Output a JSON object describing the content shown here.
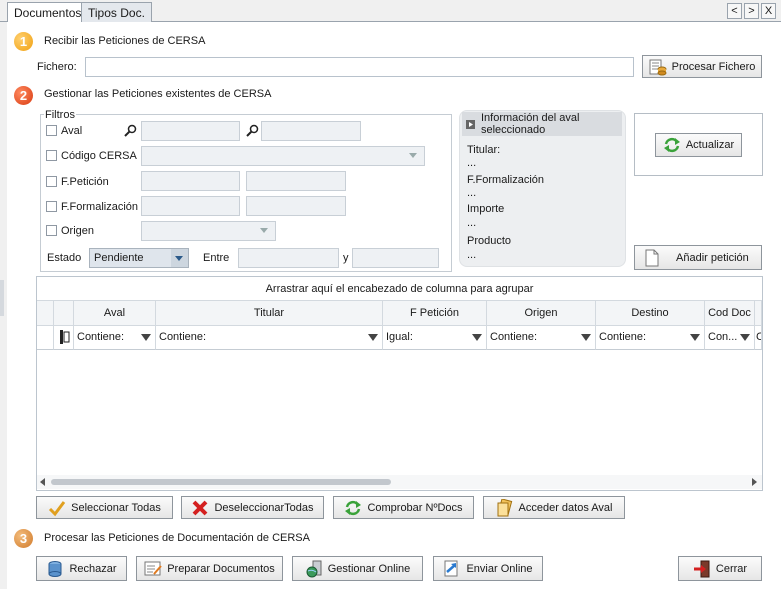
{
  "tabs": {
    "documentos": "Documentos",
    "tipos": "Tipos Doc."
  },
  "nav": {
    "prev": "<",
    "next": ">",
    "close": "X"
  },
  "step1": {
    "number": "1",
    "title": "Recibir las Peticiones de CERSA",
    "fichero_label": "Fichero:",
    "fichero_value": "",
    "procesar_btn": "Procesar Fichero"
  },
  "step2": {
    "number": "2",
    "title": "Gestionar las Peticiones existentes de CERSA"
  },
  "filtros": {
    "title": "Filtros",
    "aval": "Aval",
    "codigo": "Código CERSA",
    "fpeticion": "F.Petición",
    "fformalizacion": "F.Formalización",
    "origen": "Origen",
    "estado_label": "Estado",
    "estado_value": "Pendiente",
    "entre": "Entre",
    "y": "y"
  },
  "info": {
    "title": "Información del aval seleccionado",
    "titular": "Titular:",
    "titular_v": "...",
    "fform": "F.Formalización",
    "fform_v": "...",
    "importe": "Importe",
    "importe_v": "...",
    "producto": "Producto",
    "producto_v": "..."
  },
  "actualizar_btn": "Actualizar",
  "anadir_btn": "Añadir petición",
  "grid": {
    "group_hint": "Arrastrar aquí el encabezado de columna para agrupar",
    "columns": [
      "Aval",
      "Titular",
      "F Petición",
      "Origen",
      "Destino",
      "Cod Doc"
    ],
    "filters": [
      "Contiene:",
      "Contiene:",
      "Igual:",
      "Contiene:",
      "Contiene:",
      "Con...",
      "C"
    ]
  },
  "actions": {
    "sel_todas": "Seleccionar Todas",
    "desel_todas": "DeseleccionarTodas",
    "comprobar": "Comprobar NºDocs",
    "acceder": "Acceder datos Aval"
  },
  "step3": {
    "number": "3",
    "title": "Procesar las Peticiones de Documentación de CERSA"
  },
  "bottom": {
    "rechazar": "Rechazar",
    "preparar": "Preparar Documentos",
    "gestionar": "Gestionar Online",
    "enviar": "Enviar Online",
    "cerrar": "Cerrar"
  }
}
